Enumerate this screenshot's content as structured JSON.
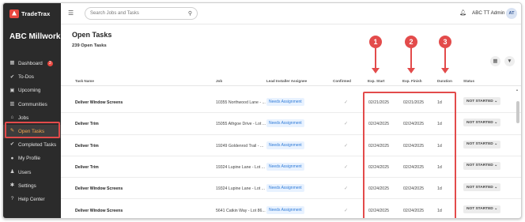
{
  "app": {
    "logo_text": "TradeTrax",
    "company": "ABC Millwork"
  },
  "sidebar": {
    "items": [
      {
        "label": "Dashboard",
        "icon": "dashboard-icon",
        "badge": "3"
      },
      {
        "label": "To-Dos",
        "icon": "check-circle-icon"
      },
      {
        "label": "Upcoming",
        "icon": "calendar-icon"
      },
      {
        "label": "Communities",
        "icon": "building-icon"
      },
      {
        "label": "Jobs",
        "icon": "home-icon"
      },
      {
        "label": "Open Tasks",
        "icon": "wrench-icon",
        "active": true
      },
      {
        "label": "Completed Tasks",
        "icon": "check-circle-icon"
      },
      {
        "label": "My Profile",
        "icon": "user-icon"
      },
      {
        "label": "Users",
        "icon": "users-icon"
      },
      {
        "label": "Settings",
        "icon": "gear-icon"
      },
      {
        "label": "Help Center",
        "icon": "help-icon"
      }
    ]
  },
  "topbar": {
    "search_placeholder": "Search Jobs and Tasks",
    "user_name": "ABC TT Admin",
    "avatar_initials": "AT"
  },
  "main": {
    "title": "Open Tasks",
    "count": "239 Open Tasks"
  },
  "table": {
    "headers": {
      "task": "Task Name",
      "job": "Job",
      "installer": "Lead Installer Assignee",
      "confirmed": "Confirmed",
      "start": "Exp. Start",
      "finish": "Exp. Finish",
      "duration": "Duration",
      "status": "Status"
    },
    "rows": [
      {
        "task": "Deliver Window Screens",
        "job": "10355 Northwood Lane - ...",
        "installer": "Needs Assignment",
        "start": "02/21/2025",
        "finish": "02/21/2025",
        "duration": "1d",
        "status": "NOT STARTED"
      },
      {
        "task": "Deliver Trim",
        "job": "15055 Athgoe Drive - Lot ...",
        "installer": "Needs Assignment",
        "start": "02/24/2025",
        "finish": "02/24/2025",
        "duration": "1d",
        "status": "NOT STARTED"
      },
      {
        "task": "Deliver Trim",
        "job": "19249 Goldenrod Trail - ...",
        "installer": "Needs Assignment",
        "start": "02/24/2025",
        "finish": "02/24/2025",
        "duration": "1d",
        "status": "NOT STARTED"
      },
      {
        "task": "Deliver Trim",
        "job": "19324 Lupine Lane - Lot ...",
        "installer": "Needs Assignment",
        "start": "02/24/2025",
        "finish": "02/24/2025",
        "duration": "1d",
        "status": "NOT STARTED"
      },
      {
        "task": "Deliver Window Screens",
        "job": "19324 Lupine Lane - Lot ...",
        "installer": "Needs Assignment",
        "start": "02/24/2025",
        "finish": "02/24/2025",
        "duration": "1d",
        "status": "NOT STARTED"
      },
      {
        "task": "Deliver Window Screens",
        "job": "5641 Catkin Way - Lot 86...",
        "installer": "Needs Assignment",
        "start": "02/24/2025",
        "finish": "02/24/2025",
        "duration": "1d",
        "status": "NOT STARTED"
      }
    ]
  },
  "annotations": {
    "markers": [
      "1",
      "2",
      "3"
    ],
    "color": "#e34b4b"
  },
  "colors": {
    "sidebar_bg": "#2b2b2b",
    "active_text": "#f2a64e",
    "accent_red": "#e8473f",
    "assign_blue": "#2f7bd8"
  }
}
